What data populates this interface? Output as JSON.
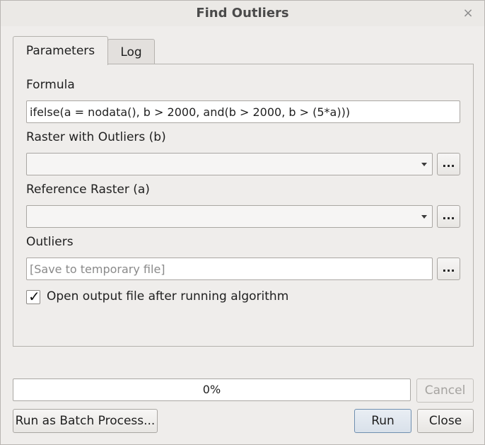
{
  "window": {
    "title": "Find Outliers",
    "close_glyph": "×",
    "close_icon": "close-icon"
  },
  "tabs": [
    {
      "label": "Parameters",
      "active": true
    },
    {
      "label": "Log",
      "active": false
    }
  ],
  "form": {
    "formula_label": "Formula",
    "formula_value": "ifelse(a = nodata(), b > 2000, and(b > 2000, b > (5*a)))",
    "raster_b_label": "Raster with Outliers (b)",
    "raster_b_value": "",
    "raster_a_label": "Reference Raster (a)",
    "raster_a_value": "",
    "outliers_label": "Outliers",
    "outliers_placeholder": "[Save to temporary file]",
    "browse_label": "...",
    "open_output_label": "Open output file after running algorithm",
    "open_output_checked": true,
    "check_glyph": "✓"
  },
  "progress": {
    "value": 0,
    "text": "0%"
  },
  "buttons": {
    "cancel": "Cancel",
    "batch": "Run as Batch Process...",
    "run": "Run",
    "close": "Close"
  },
  "colors": {
    "background": "#efedeb",
    "progress_fill": "#4a90d9",
    "disabled_text": "#a5a3a0"
  }
}
